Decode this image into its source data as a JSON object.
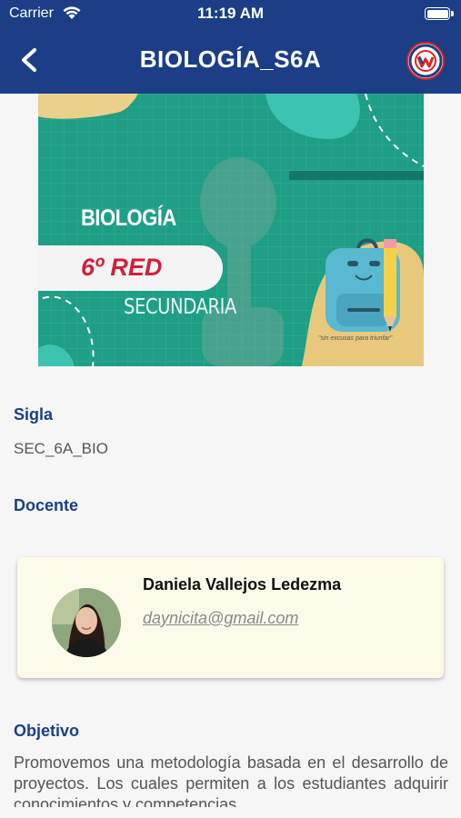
{
  "status_bar": {
    "carrier": "Carrier",
    "time": "11:19 AM"
  },
  "nav": {
    "title": "BIOLOGÍA_S6A"
  },
  "banner": {
    "subject": "BIOLOGÍA",
    "grade": "6º RED",
    "level": "SECUNDARIA",
    "slogan": "\"sin excusas para triunfar\""
  },
  "course": {
    "code_label": "Sigla",
    "code_value": "SEC_6A_BIO",
    "teacher_label": "Docente",
    "teacher": {
      "name": "Daniela Vallejos Ledezma",
      "email": "daynicita@gmail.com"
    },
    "objective_label": "Objetivo",
    "objective_text": "Promovemos una metodología basada en el desarrollo de proyectos. Los cuales permiten a los estudiantes adquirir conocimientos y competencias"
  },
  "colors": {
    "nav_bg": "#1b3e86",
    "accent": "#1b3e86",
    "banner_bg": "#1e9e85",
    "card_bg": "#fcfbe9"
  }
}
